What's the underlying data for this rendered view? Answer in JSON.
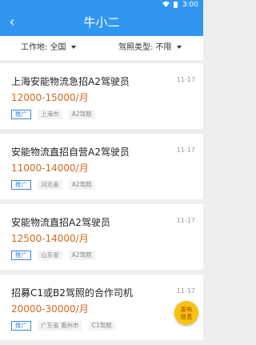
{
  "status_bar": {
    "time": "3:00"
  },
  "header": {
    "title": "牛小二",
    "back_symbol": "‹"
  },
  "filters": {
    "location_label": "工作地:",
    "location_value": "全国",
    "license_label": "驾照类型:",
    "license_value": "不限"
  },
  "jobs": [
    {
      "title": "上海安能物流急招A2驾驶员",
      "date": "11-17",
      "salary": "12000-15000/月",
      "tags": [
        "推广",
        "上海市",
        "A2驾照"
      ]
    },
    {
      "title": "安能物流直招自营A2驾驶员",
      "date": "11-17",
      "salary": "11000-14000/月",
      "tags": [
        "推广",
        "河北省",
        "A2驾照"
      ]
    },
    {
      "title": "安能物流直招A2驾驶员",
      "date": "11-17",
      "salary": "12500-14000/月",
      "tags": [
        "推广",
        "山东省",
        "A2驾照"
      ]
    },
    {
      "title": "招募C1或B2驾照的合作司机",
      "date": "11-17",
      "salary": "20000-30000/月",
      "tags": [
        "推广",
        "广东省 惠州市",
        "C1驾照"
      ]
    }
  ],
  "fab": {
    "line1": "发布",
    "line2": "信息"
  },
  "colors": {
    "primary": "#3196f0",
    "salary": "#d2691e",
    "fab": "#f7c30f"
  }
}
